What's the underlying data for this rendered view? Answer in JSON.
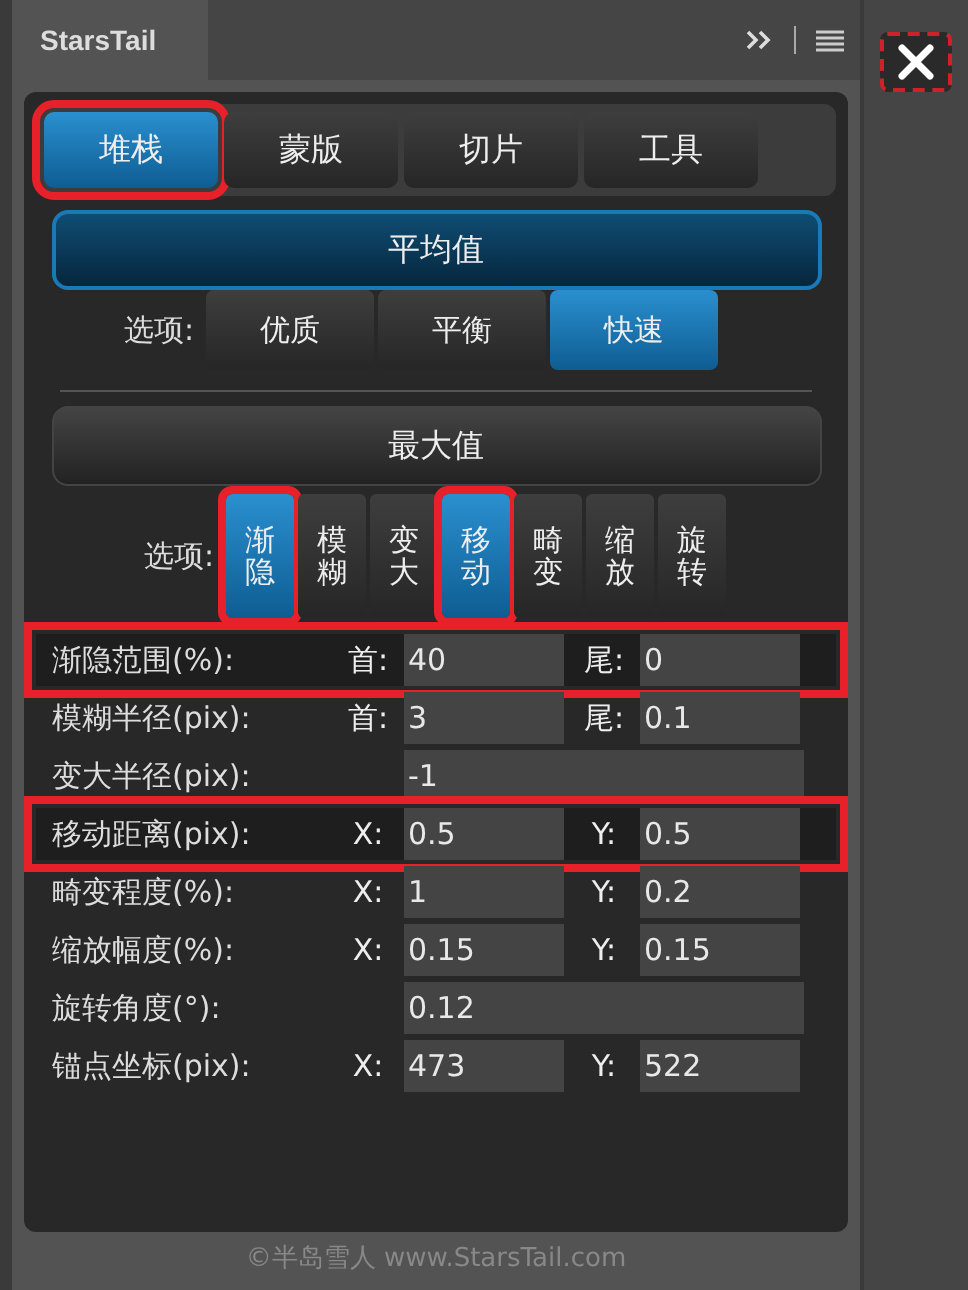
{
  "panel": {
    "title": "StarsTail"
  },
  "tabs": [
    {
      "label": "堆栈",
      "selected": true,
      "highlighted": true
    },
    {
      "label": "蒙版",
      "selected": false,
      "highlighted": false
    },
    {
      "label": "切片",
      "selected": false,
      "highlighted": false
    },
    {
      "label": "工具",
      "selected": false,
      "highlighted": false
    }
  ],
  "average_button": "平均值",
  "average_options": {
    "label": "选项:",
    "items": [
      {
        "label": "优质",
        "selected": false
      },
      {
        "label": "平衡",
        "selected": false
      },
      {
        "label": "快速",
        "selected": true
      }
    ]
  },
  "max_button": "最大值",
  "max_options": {
    "label": "选项:",
    "items": [
      {
        "label": "渐隐",
        "selected": true,
        "highlighted": true
      },
      {
        "label": "模糊",
        "selected": false,
        "highlighted": false
      },
      {
        "label": "变大",
        "selected": false,
        "highlighted": false
      },
      {
        "label": "移动",
        "selected": true,
        "highlighted": true
      },
      {
        "label": "畸变",
        "selected": false,
        "highlighted": false
      },
      {
        "label": "缩放",
        "selected": false,
        "highlighted": false
      },
      {
        "label": "旋转",
        "selected": false,
        "highlighted": false
      }
    ]
  },
  "params": [
    {
      "kind": "pair",
      "label": "渐隐范围(%):",
      "highlighted": true,
      "a_label": "首:",
      "a_value": "40",
      "b_label": "尾:",
      "b_value": "0"
    },
    {
      "kind": "pair",
      "label": "模糊半径(pix):",
      "highlighted": false,
      "a_label": "首:",
      "a_value": "3",
      "b_label": "尾:",
      "b_value": "0.1"
    },
    {
      "kind": "single",
      "label": "变大半径(pix):",
      "highlighted": false,
      "value": "-1"
    },
    {
      "kind": "pair",
      "label": "移动距离(pix):",
      "highlighted": true,
      "a_label": "X:",
      "a_value": "0.5",
      "b_label": "Y:",
      "b_value": "0.5"
    },
    {
      "kind": "pair",
      "label": "畸变程度(%):",
      "highlighted": false,
      "a_label": "X:",
      "a_value": "1",
      "b_label": "Y:",
      "b_value": "0.2"
    },
    {
      "kind": "pair",
      "label": "缩放幅度(%):",
      "highlighted": false,
      "a_label": "X:",
      "a_value": "0.15",
      "b_label": "Y:",
      "b_value": "0.15"
    },
    {
      "kind": "single",
      "label": "旋转角度(°):",
      "highlighted": false,
      "value": "0.12"
    },
    {
      "kind": "pair",
      "label": "锚点坐标(pix):",
      "highlighted": false,
      "a_label": "X:",
      "a_value": "473",
      "b_label": "Y:",
      "b_value": "522"
    }
  ],
  "footer": "©半岛雪人 www.StarsTail.com"
}
